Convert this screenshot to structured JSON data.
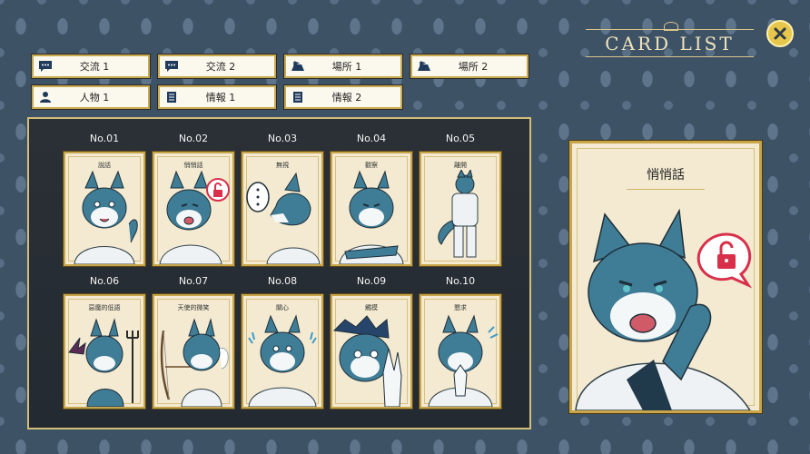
{
  "header": {
    "title": "CARD LIST"
  },
  "tabs": [
    {
      "label": "交流 1",
      "icon": "chat-bubble-icon"
    },
    {
      "label": "交流 2",
      "icon": "chat-bubble-icon"
    },
    {
      "label": "場所 1",
      "icon": "location-icon"
    },
    {
      "label": "場所 2",
      "icon": "location-icon"
    },
    {
      "label": "人物 1",
      "icon": "person-icon"
    },
    {
      "label": "情報 1",
      "icon": "document-icon"
    },
    {
      "label": "情報 2",
      "icon": "document-icon"
    }
  ],
  "cards": [
    {
      "number": "No.01",
      "name": "說話"
    },
    {
      "number": "No.02",
      "name": "悄悄話"
    },
    {
      "number": "No.03",
      "name": "無視"
    },
    {
      "number": "No.04",
      "name": "觀察"
    },
    {
      "number": "No.05",
      "name": "離開"
    },
    {
      "number": "No.06",
      "name": "惡魔的低語"
    },
    {
      "number": "No.07",
      "name": "天使的微笑"
    },
    {
      "number": "No.08",
      "name": "關心"
    },
    {
      "number": "No.09",
      "name": "觸摸"
    },
    {
      "number": "No.10",
      "name": "懇求"
    }
  ],
  "detail": {
    "name": "悄悄話"
  },
  "colors": {
    "panel_border": "#c7a548",
    "card_bg": "#f3ead1",
    "fur_blue": "#3f7d96",
    "lock_red": "#d8304a"
  }
}
